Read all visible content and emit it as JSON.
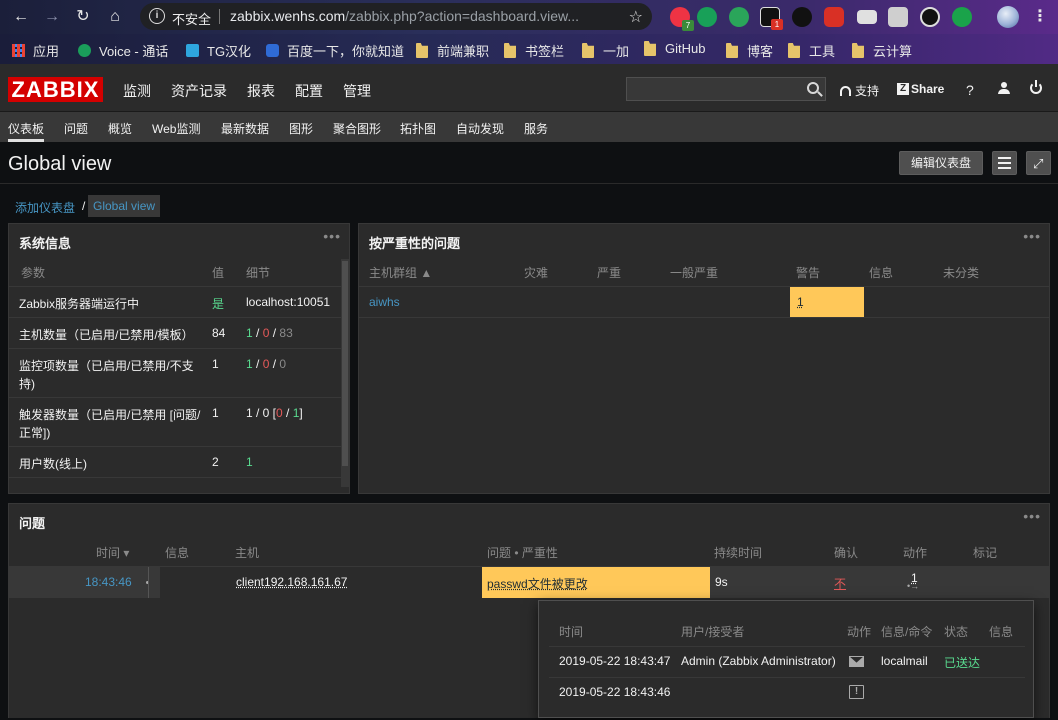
{
  "browser": {
    "insecure_label": "不安全",
    "url_host": "zabbix.wenhs.com",
    "url_path": "/zabbix.php?action=dashboard.view...",
    "extension_badges": [
      "7",
      "1"
    ],
    "bookmarks": [
      {
        "label": "应用",
        "icon": "apps-grid-icon"
      },
      {
        "label": "Voice - 通话",
        "icon": "voice-icon"
      },
      {
        "label": "TG汉化",
        "icon": "telegram-icon"
      },
      {
        "label": "百度一下，你就知道",
        "icon": "baidu-icon"
      },
      {
        "label": "前端兼职",
        "icon": "folder-icon"
      },
      {
        "label": "书签栏",
        "icon": "folder-icon"
      },
      {
        "label": "一加",
        "icon": "folder-icon"
      },
      {
        "label": "GitHub",
        "icon": "folder-icon"
      },
      {
        "label": "博客",
        "icon": "folder-icon"
      },
      {
        "label": "工具",
        "icon": "folder-icon"
      },
      {
        "label": "云计算",
        "icon": "folder-icon"
      }
    ]
  },
  "header": {
    "logo": "ZABBIX",
    "menu": [
      "监测",
      "资产记录",
      "报表",
      "配置",
      "管理"
    ],
    "support_label": "支持",
    "share_label": "Share",
    "help_label": "?",
    "search_value": ""
  },
  "submenu": [
    "仪表板",
    "问题",
    "概览",
    "Web监测",
    "最新数据",
    "图形",
    "聚合图形",
    "拓扑图",
    "自动发现",
    "服务"
  ],
  "page": {
    "title": "Global view",
    "edit_button": "编辑仪表盘",
    "breadcrumb_parent": "添加仪表盘",
    "breadcrumb_sep": "/",
    "breadcrumb_current": "Global view"
  },
  "sysinfo": {
    "title": "系统信息",
    "headers": {
      "param": "参数",
      "value": "值",
      "detail": "细节"
    },
    "rows": [
      {
        "param": "Zabbix服务器端运行中",
        "value": "是",
        "detail": "localhost:10051"
      },
      {
        "param": "主机数量（已启用/已禁用/模板）",
        "value": "84",
        "d1": "1",
        "s1": " / ",
        "d2": "0",
        "s2": " / ",
        "d3": "83"
      },
      {
        "param1": "监控项数量（已启用/已禁用/不支",
        "param2": "持)",
        "value": "1",
        "d1": "1",
        "s1": " / ",
        "d2": "0",
        "s2": " / ",
        "d3": "0"
      },
      {
        "param1": "触发器数量（已启用/已禁用 [问题/",
        "param2": "正常])",
        "value": "1",
        "d0": "1 / 0 [",
        "d1": "0",
        "s1": " / ",
        "d2": "1",
        "s2": "]"
      },
      {
        "param": "用户数(线上)",
        "value": "2",
        "detail": "1"
      }
    ]
  },
  "severity": {
    "title": "按严重性的问题",
    "headers": [
      "主机群组 ▲",
      "灾难",
      "严重",
      "一般严重",
      "警告",
      "信息",
      "未分类"
    ],
    "rows": [
      {
        "group": "aiwhs",
        "warning": "1"
      }
    ],
    "colors": {
      "warning": "#ffc859"
    }
  },
  "problems": {
    "title": "问题",
    "headers": {
      "time": "时间 ▾",
      "info": "信息",
      "host": "主机",
      "problem": "问题 • 严重性",
      "duration": "持续时间",
      "ack": "确认",
      "actions": "动作",
      "tags": "标记"
    },
    "rows": [
      {
        "time": "18:43:46",
        "host": "client192.168.161.67",
        "problem": "passwd文件被更改",
        "duration": "9s",
        "ack": "不",
        "actions": "1"
      }
    ]
  },
  "popup": {
    "headers": {
      "time": "时间",
      "user": "用户/接受者",
      "action": "动作",
      "info_cmd": "信息/命令",
      "status": "状态",
      "info": "信息"
    },
    "rows": [
      {
        "time": "2019-05-22 18:43:47",
        "user": "Admin (Zabbix Administrator)",
        "action_icon": "envelope-icon",
        "cmd": "localmail",
        "status": "已送达"
      },
      {
        "time": "2019-05-22 18:43:46",
        "user": "",
        "action_icon": "event-alert-icon",
        "cmd": "",
        "status": ""
      }
    ]
  }
}
